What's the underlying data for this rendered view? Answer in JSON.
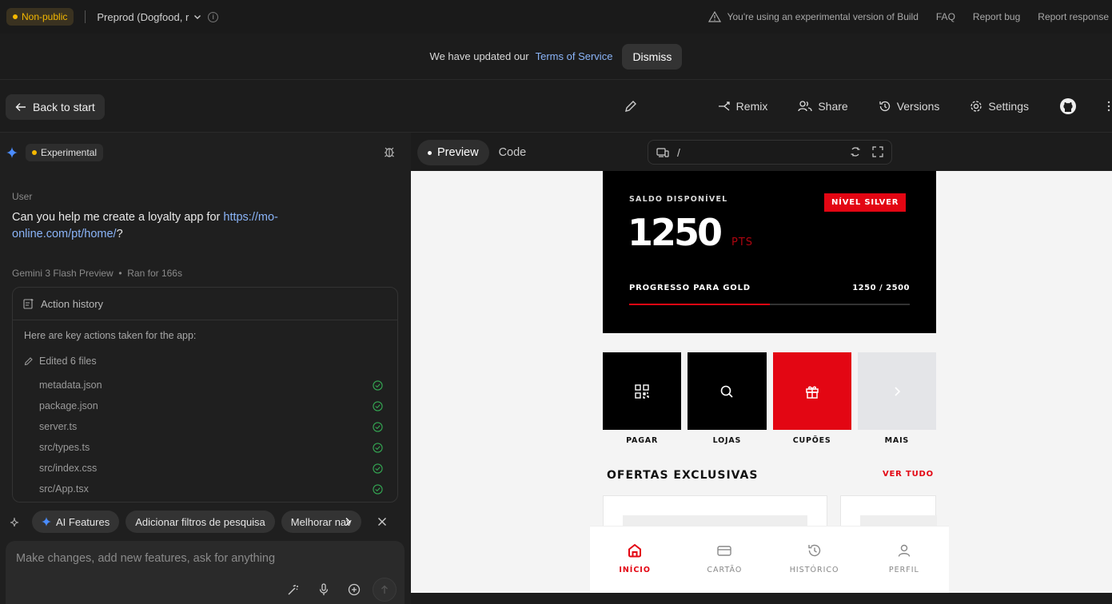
{
  "topbar": {
    "visibility_badge": "Non-public",
    "environment": "Preprod (Dogfood, r",
    "warning": "You're using an experimental version of Build",
    "links": [
      "FAQ",
      "Report bug",
      "Report response"
    ]
  },
  "tos_banner": {
    "text": "We have updated our",
    "link": "Terms of Service",
    "dismiss": "Dismiss"
  },
  "toolbar": {
    "back": "Back to start",
    "remix": "Remix",
    "share": "Share",
    "versions": "Versions",
    "settings": "Settings"
  },
  "chat": {
    "experimental_badge": "Experimental",
    "user_label": "User",
    "user_message_prefix": "Can you help me create a loyalty app for ",
    "user_message_link": "https://mo-online.com/pt/home/",
    "user_message_suffix": "?",
    "model_label": "Gemini 3 Flash Preview",
    "run_time": "Ran for 166s",
    "action_history": {
      "title": "Action history",
      "intro": "Here are key actions taken for the app:",
      "edited": "Edited 6 files",
      "files": [
        "metadata.json",
        "package.json",
        "server.ts",
        "src/types.ts",
        "src/index.css",
        "src/App.tsx"
      ]
    },
    "chips": [
      "AI Features",
      "Adicionar filtros de pesquisa",
      "Melhorar nav"
    ],
    "input_placeholder": "Make changes, add new features, ask for anything"
  },
  "preview_header": {
    "tab_preview": "Preview",
    "tab_code": "Code",
    "url": "/"
  },
  "app": {
    "saldo_label": "SALDO DISPONÍVEL",
    "level_badge": "NÍVEL SILVER",
    "points": "1250",
    "points_unit": "PTS",
    "progress_label": "PROGRESSO PARA GOLD",
    "progress_text": "1250 / 2500",
    "progress_fraction": 0.5,
    "tiles": [
      {
        "label": "PAGAR",
        "icon": "qr-code-icon"
      },
      {
        "label": "LOJAS",
        "icon": "search-icon"
      },
      {
        "label": "CUPÕES",
        "icon": "gift-icon"
      },
      {
        "label": "MAIS",
        "icon": "chevron-right-icon"
      }
    ],
    "offers_title": "OFERTAS EXCLUSIVAS",
    "see_all": "VER TUDO",
    "nav": [
      {
        "label": "INÍCIO",
        "icon": "home-icon",
        "active": true
      },
      {
        "label": "CARTÃO",
        "icon": "card-icon",
        "active": false
      },
      {
        "label": "HISTÓRICO",
        "icon": "history-icon",
        "active": false
      },
      {
        "label": "PERFIL",
        "icon": "user-icon",
        "active": false
      }
    ]
  },
  "colors": {
    "accent_red": "#e30613",
    "badge_yellow": "#f5b800",
    "link_blue": "#8ab4f8",
    "success_green": "#34a853"
  }
}
